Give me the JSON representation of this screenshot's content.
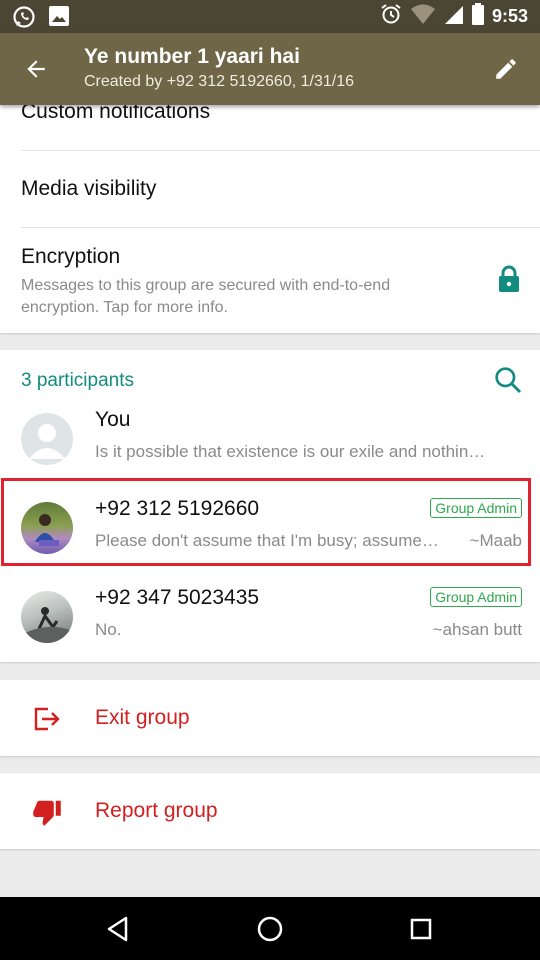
{
  "status_bar": {
    "time": "9:53",
    "icons_left": [
      "whatsapp-icon",
      "image-icon"
    ],
    "icons_right": [
      "alarm-icon",
      "wifi-icon",
      "signal-icon",
      "battery-icon"
    ]
  },
  "app_bar": {
    "title": "Ye number 1 yaari hai",
    "subtitle": "Created by +92 312 5192660, 1/31/16",
    "back_icon": "arrow-back-icon",
    "edit_icon": "pencil-icon",
    "color": "#6f6547"
  },
  "settings": {
    "custom_notifications": "Custom notifications",
    "media_visibility": "Media visibility",
    "encryption_title": "Encryption",
    "encryption_desc": "Messages to this group are secured with end-to-end encryption. Tap for more info."
  },
  "participants": {
    "count_label": "3 participants",
    "list": [
      {
        "name": "You",
        "status": "Is it possible that existence is our exile and nothin…",
        "nickname": "",
        "badge": ""
      },
      {
        "name": "+92 312 5192660",
        "status": "Please don't assume that I'm busy; assume…",
        "nickname": "~Maab",
        "badge": "Group Admin"
      },
      {
        "name": "+92 347 5023435",
        "status": "No.",
        "nickname": "~ahsan butt",
        "badge": "Group Admin"
      }
    ]
  },
  "actions": {
    "exit": "Exit group",
    "report": "Report group"
  },
  "colors": {
    "accent": "#128c7e",
    "danger": "#d21f1f",
    "admin_green": "#2fa84f",
    "highlight": "#e0222e"
  }
}
